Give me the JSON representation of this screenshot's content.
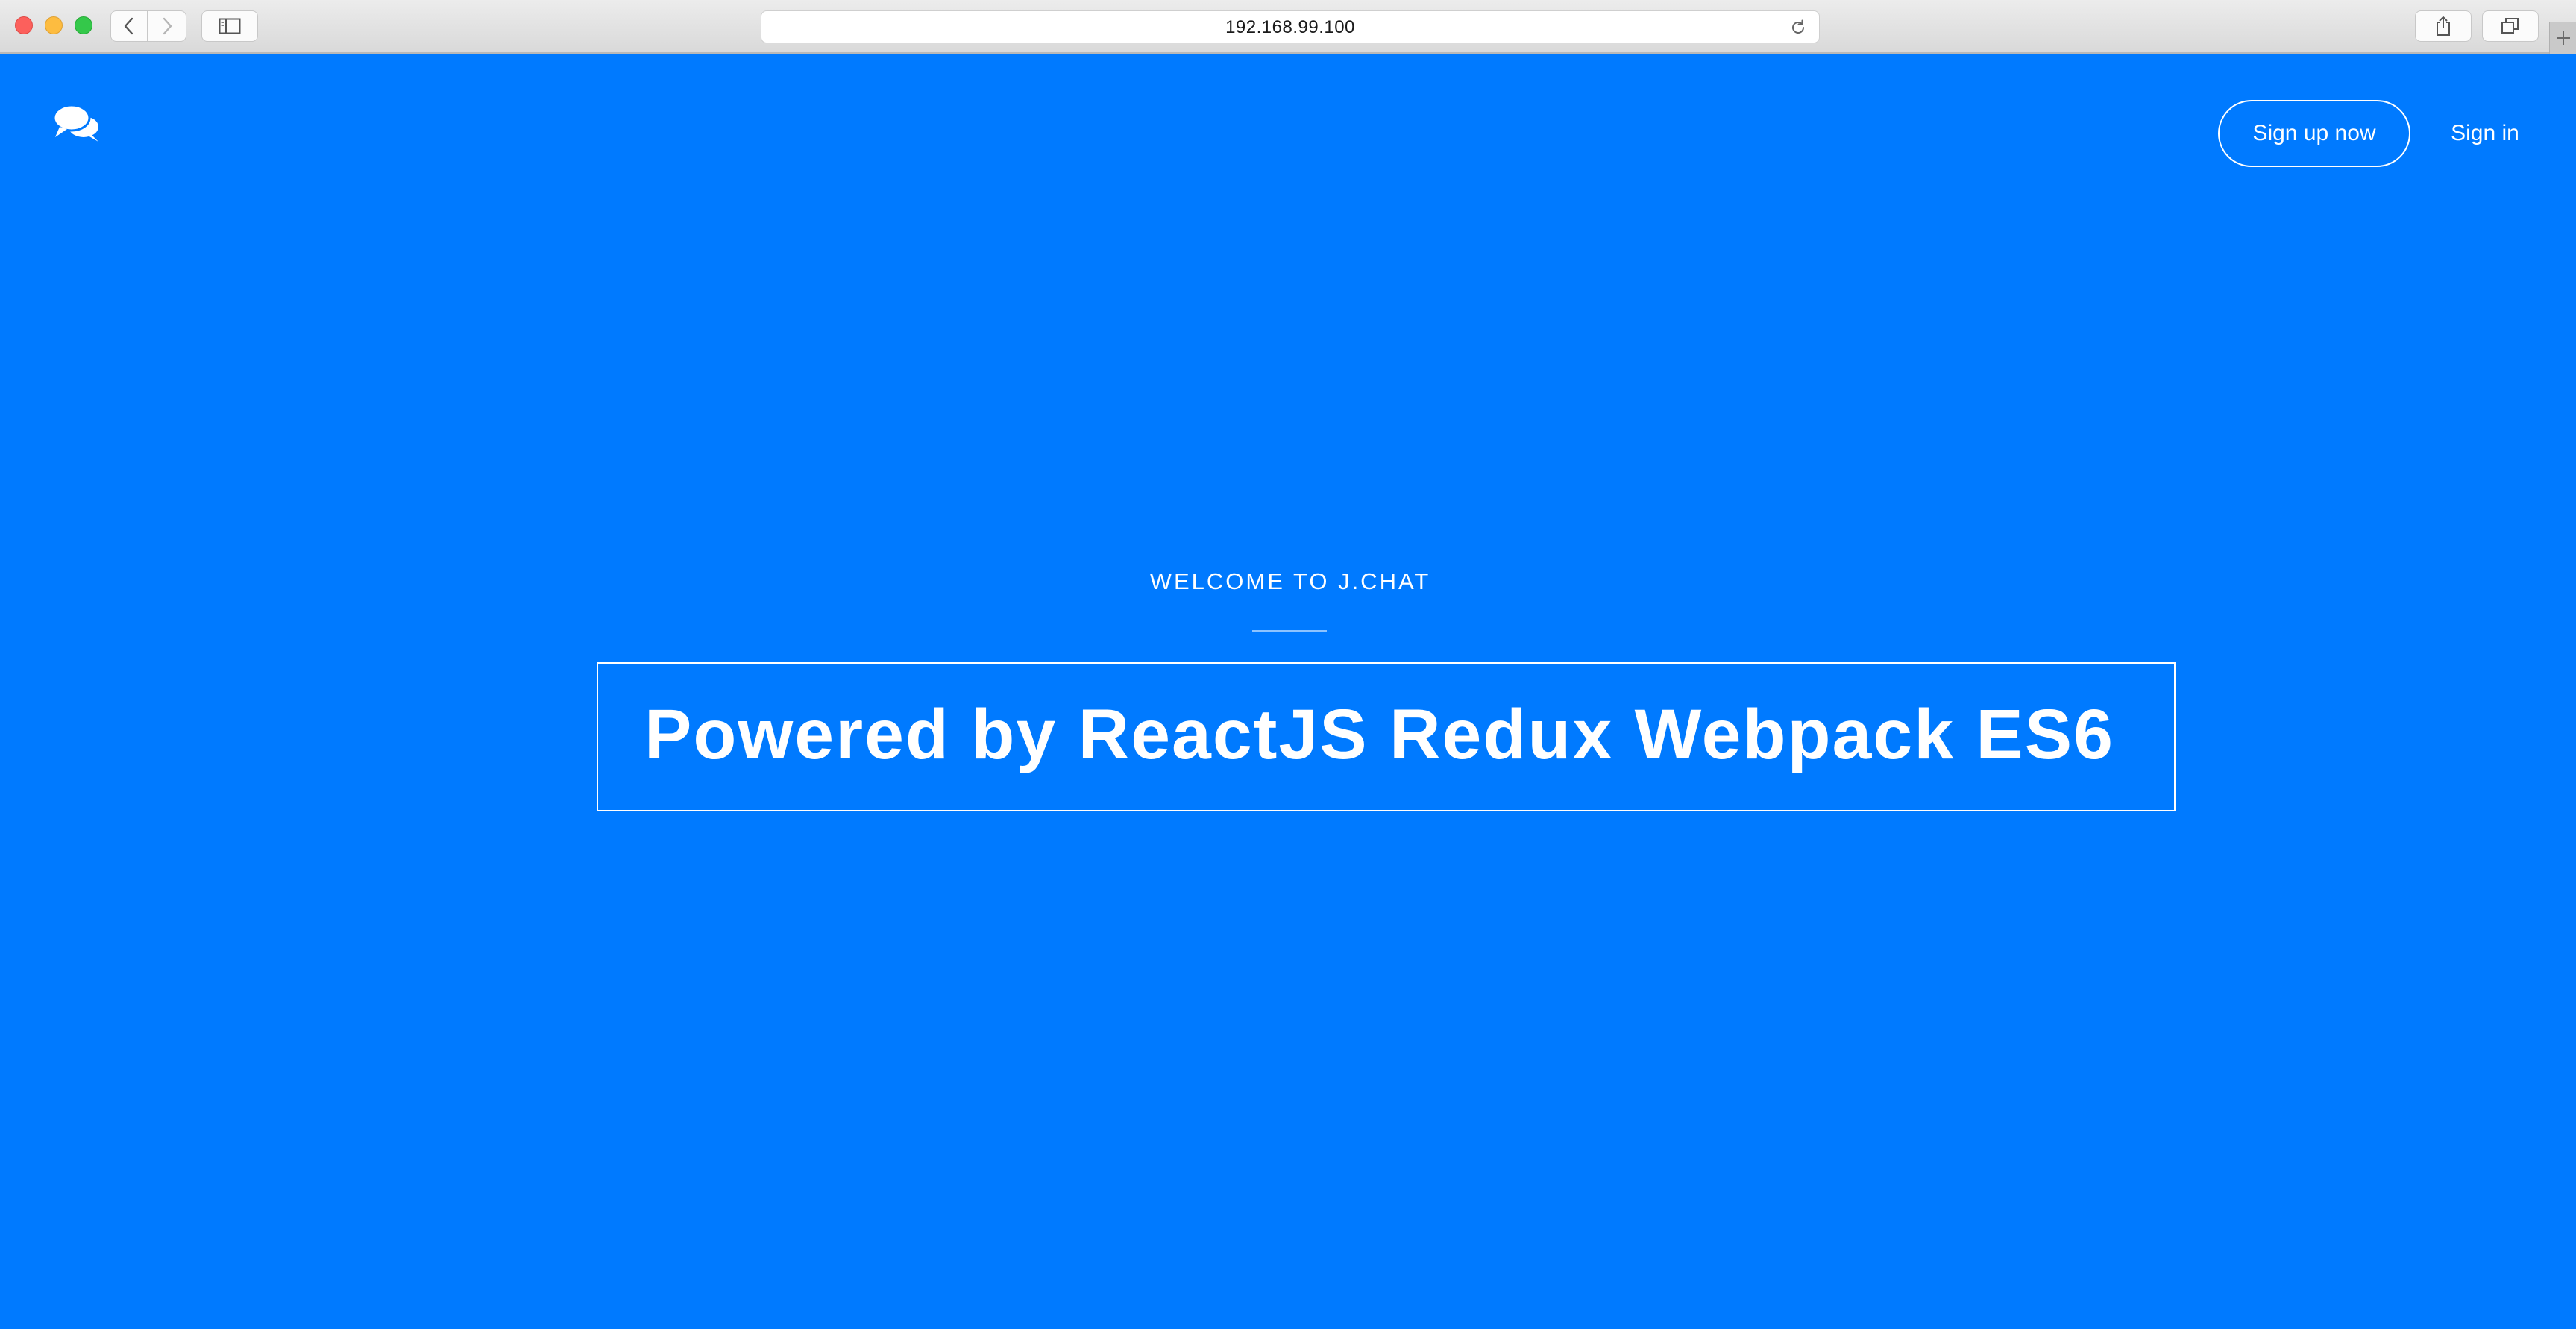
{
  "browser": {
    "url": "192.168.99.100",
    "icons": {
      "back": "chevron-left-icon",
      "forward": "chevron-right-icon",
      "sidebar": "sidebar-icon",
      "reload": "reload-icon",
      "share": "share-icon",
      "tabs": "tabs-overview-icon",
      "new_tab": "plus-icon"
    }
  },
  "page": {
    "background_color": "#007aff",
    "logo_icon": "chat-bubbles-icon",
    "nav": {
      "signup_label": "Sign up now",
      "signin_label": "Sign in"
    },
    "hero": {
      "welcome": "WELCOME TO J.CHAT",
      "headline": "Powered by ReactJS Redux Webpack ES6"
    }
  }
}
